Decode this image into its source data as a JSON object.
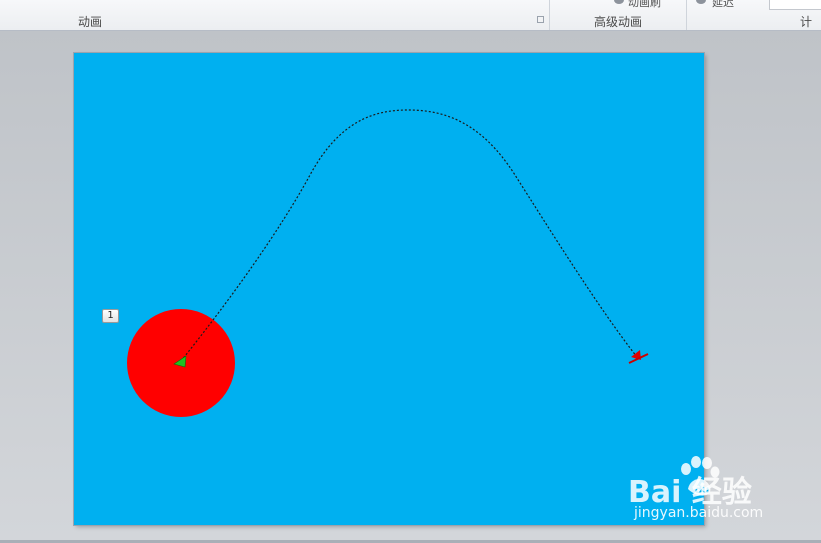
{
  "ribbon": {
    "group_animation_label": "动画",
    "group_advanced_label": "高级动画",
    "group_timing_label": "计时",
    "fragment_text_1": "动画刷",
    "fragment_text_2": "延迟",
    "launcher_icon": "dialog-launcher-icon"
  },
  "slide": {
    "background_color": "#00b0f0",
    "animation_tag": "1",
    "shape_fill": "#ff0000",
    "motion_path": "curved-arc",
    "start_marker": "green-triangle",
    "end_marker": "red-triangle"
  },
  "watermark": {
    "brand": "Bai  经验",
    "url": "jingyan.baidu.com"
  }
}
